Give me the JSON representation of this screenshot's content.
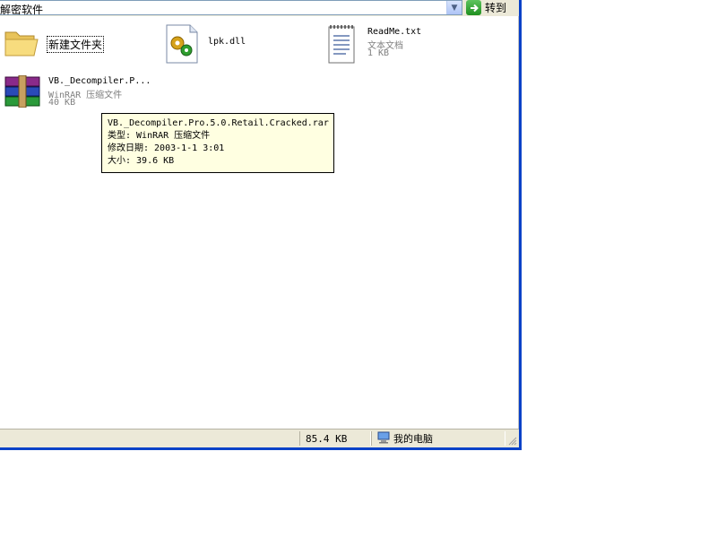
{
  "address": {
    "value": "解密软件",
    "dropdown_glyph": "▼",
    "go_label": "转到"
  },
  "files": [
    {
      "name": "新建文件夹",
      "icon": "folder-icon"
    },
    {
      "name": "lpk.dll",
      "icon": "dll-icon"
    },
    {
      "name": "ReadMe.txt",
      "type": "文本文档",
      "size": "1 KB",
      "icon": "text-document-icon"
    },
    {
      "name": "VB._Decompiler.P...",
      "type": "WinRAR 压缩文件",
      "size": "40 KB",
      "icon": "winrar-archive-icon"
    }
  ],
  "tooltip": {
    "filename": "VB._Decompiler.Pro.5.0.Retail.Cracked.rar",
    "type_line": "类型: WinRAR 压缩文件",
    "date_line": "修改日期: 2003-1-1 3:01",
    "size_line": "大小: 39.6 KB"
  },
  "status_bar": {
    "total_size": "85.4 KB",
    "location": "我的电脑",
    "location_icon": "my-computer-icon"
  },
  "colors": {
    "window_border": "#0a42c8",
    "chrome": "#ece9d8",
    "tooltip_bg": "#ffffe1"
  }
}
